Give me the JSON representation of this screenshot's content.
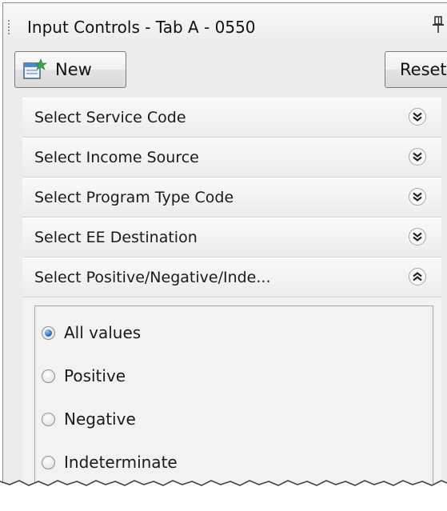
{
  "panel": {
    "title": "Input Controls - Tab A - 0550",
    "pin_icon": "pin-icon"
  },
  "toolbar": {
    "new_label": "New",
    "new_icon": "new-document-icon",
    "reset_label": "Reset"
  },
  "accordion": {
    "sections": [
      {
        "label": "Select Service Code",
        "expanded": false
      },
      {
        "label": "Select Income Source",
        "expanded": false
      },
      {
        "label": "Select Program Type Code",
        "expanded": false
      },
      {
        "label": "Select EE Destination",
        "expanded": false
      },
      {
        "label": "Select Positive/Negative/Inde...",
        "expanded": true
      }
    ],
    "options": [
      {
        "label": "All values",
        "checked": true
      },
      {
        "label": "Positive",
        "checked": false
      },
      {
        "label": "Negative",
        "checked": false
      },
      {
        "label": "Indeterminate",
        "checked": false
      }
    ]
  },
  "colors": {
    "panel_bg": "#ececec",
    "radio_selected": "#1b5fbf"
  }
}
